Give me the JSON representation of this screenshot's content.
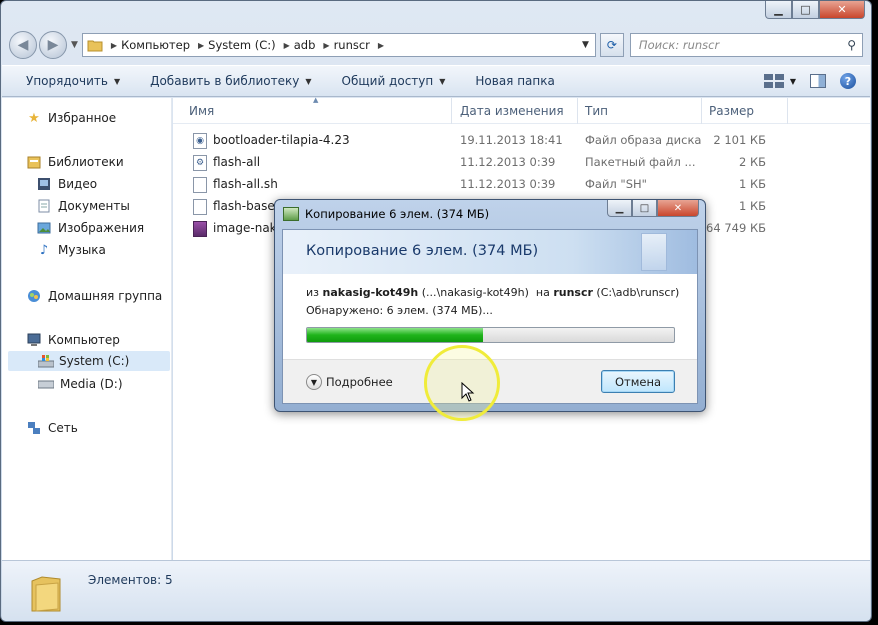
{
  "window": {
    "caption_buttons": {
      "minimize": "▁",
      "maximize": "□",
      "close": "✕"
    }
  },
  "address": {
    "back_icon": "back-arrow-icon",
    "forward_icon": "forward-arrow-icon",
    "breadcrumbs": [
      "Компьютер",
      "System (C:)",
      "adb",
      "runscr"
    ],
    "search_placeholder": "Поиск: runscr"
  },
  "toolbar": {
    "organize": "Упорядочить",
    "add_to_library": "Добавить в библиотеку",
    "share": "Общий доступ",
    "new_folder": "Новая папка"
  },
  "nav": {
    "favorites": "Избранное",
    "libraries": "Библиотеки",
    "video": "Видео",
    "documents": "Документы",
    "images": "Изображения",
    "music": "Музыка",
    "homegroup": "Домашняя группа",
    "computer": "Компьютер",
    "system_c": "System (C:)",
    "media_d": "Media (D:)",
    "network": "Сеть"
  },
  "columns": {
    "name": "Имя",
    "date": "Дата изменения",
    "type": "Тип",
    "size": "Размер"
  },
  "files": [
    {
      "name": "bootloader-tilapia-4.23",
      "date": "19.11.2013 18:41",
      "type": "Файл образа диска",
      "size": "2 101 КБ"
    },
    {
      "name": "flash-all",
      "date": "11.12.2013 0:39",
      "type": "Пакетный файл ...",
      "size": "2 КБ"
    },
    {
      "name": "flash-all.sh",
      "date": "11.12.2013 0:39",
      "type": "Файл \"SH\"",
      "size": "1 КБ"
    },
    {
      "name": "flash-base.s",
      "date": "",
      "type": "",
      "size": "1 КБ"
    },
    {
      "name": "image-naka",
      "date": "",
      "type": "",
      "size": "364 749 КБ"
    }
  ],
  "status": {
    "items": "Элементов: 5"
  },
  "dialog": {
    "title": "Копирование 6 элем. (374 МБ)",
    "header": "Копирование 6 элем. (374 МБ)",
    "from_prefix": "из",
    "from_name": "nakasig-kot49h",
    "from_path": "(...\\nakasig-kot49h)",
    "to_prefix": "на",
    "to_name": "runscr",
    "to_path": "(C:\\adb\\runscr)",
    "found": "Обнаружено: 6 элем. (374 МБ)...",
    "progress_percent": 48,
    "more": "Подробнее",
    "cancel": "Отмена"
  },
  "colors": {
    "accent": "#1e395b",
    "progress": "#1fb41b",
    "highlight": "#f0ec3a"
  }
}
